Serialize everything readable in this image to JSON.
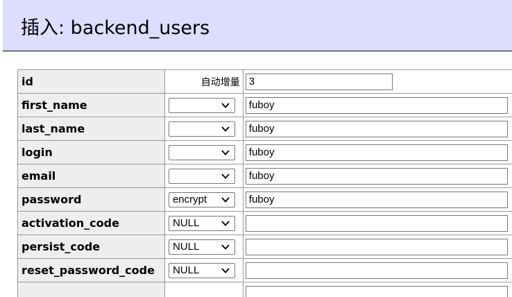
{
  "header": {
    "title": "插入: backend_users"
  },
  "rows": [
    {
      "name": "id",
      "func_kind": "text",
      "func_text": "自动增量",
      "value": "3",
      "input_kind": "short"
    },
    {
      "name": "first_name",
      "func_kind": "select",
      "func_text": "",
      "value": "fuboy",
      "input_kind": "long"
    },
    {
      "name": "last_name",
      "func_kind": "select",
      "func_text": "",
      "value": "fuboy",
      "input_kind": "long"
    },
    {
      "name": "login",
      "func_kind": "select",
      "func_text": "",
      "value": "fuboy",
      "input_kind": "long"
    },
    {
      "name": "email",
      "func_kind": "select",
      "func_text": "",
      "value": "fuboy",
      "input_kind": "long"
    },
    {
      "name": "password",
      "func_kind": "select",
      "func_text": "encrypt",
      "value": "fuboy",
      "input_kind": "long"
    },
    {
      "name": "activation_code",
      "func_kind": "select",
      "func_text": "NULL",
      "value": "",
      "input_kind": "long"
    },
    {
      "name": "persist_code",
      "func_kind": "select",
      "func_text": "NULL",
      "value": "",
      "input_kind": "long"
    },
    {
      "name": "reset_password_code",
      "func_kind": "select",
      "func_text": "NULL",
      "value": "",
      "input_kind": "long"
    },
    {
      "name": "",
      "func_kind": "none",
      "func_text": "",
      "value": "",
      "input_kind": "long"
    }
  ],
  "colors": {
    "header_bg": "#ddddff",
    "label_bg": "#eeeeee",
    "grid": "#999999"
  },
  "icons": {
    "select_arrow": "chevron-down-icon"
  }
}
